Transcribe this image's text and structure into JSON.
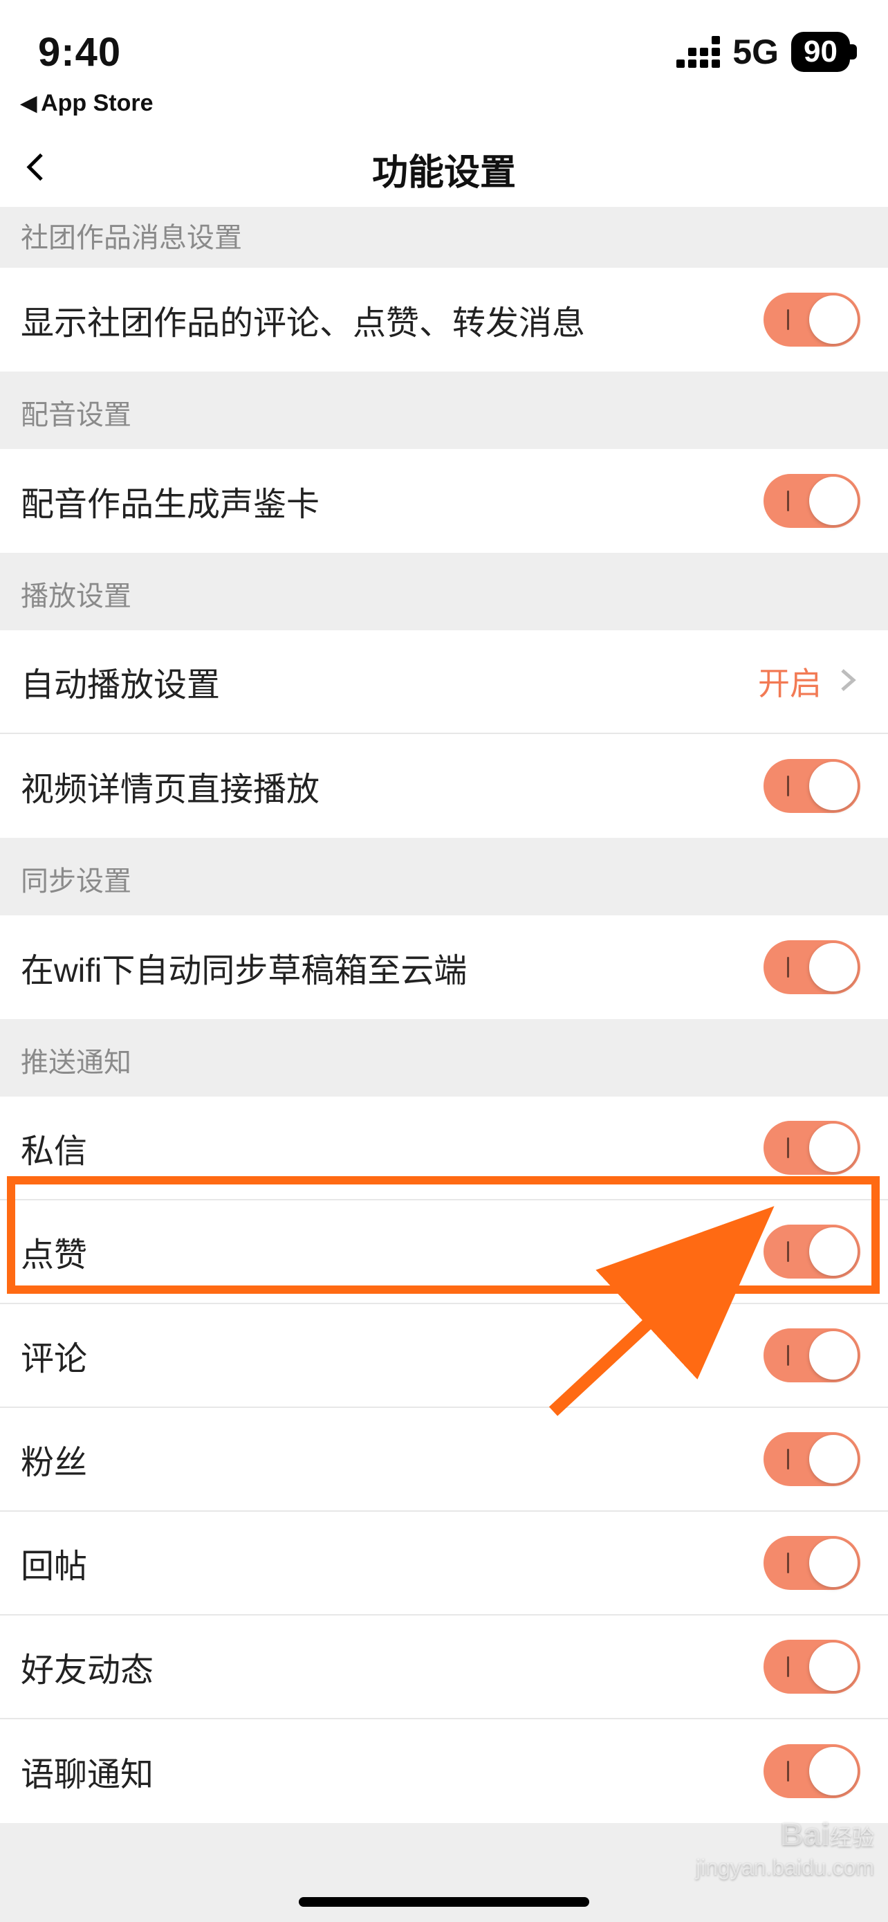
{
  "statusbar": {
    "time": "9:40",
    "network": "5G",
    "battery": "90"
  },
  "breadcrumb": {
    "back_to": "App Store"
  },
  "nav": {
    "title": "功能设置"
  },
  "sections": {
    "s0": {
      "header": "社团作品消息设置"
    },
    "s1": {
      "header": "配音设置"
    },
    "s2": {
      "header": "播放设置"
    },
    "s3": {
      "header": "同步设置"
    },
    "s4": {
      "header": "推送通知"
    }
  },
  "rows": {
    "r0": {
      "label": "显示社团作品的评论、点赞、转发消息",
      "toggle": true
    },
    "r1": {
      "label": "配音作品生成声鉴卡",
      "toggle": true
    },
    "r2": {
      "label": "自动播放设置",
      "value": "开启"
    },
    "r3": {
      "label": "视频详情页直接播放",
      "toggle": true
    },
    "r4": {
      "label": "在wifi下自动同步草稿箱至云端",
      "toggle": true
    },
    "r5": {
      "label": "私信",
      "toggle": true
    },
    "r6": {
      "label": "点赞",
      "toggle": true
    },
    "r7": {
      "label": "评论",
      "toggle": true
    },
    "r8": {
      "label": "粉丝",
      "toggle": true
    },
    "r9": {
      "label": "回帖",
      "toggle": true
    },
    "r10": {
      "label": "好友动态",
      "toggle": true
    },
    "r11": {
      "label": "语聊通知",
      "toggle": true
    }
  },
  "watermark": {
    "brand": "Bai",
    "brand2": "经验",
    "sub": "jingyan.baidu.com"
  },
  "colors": {
    "accent": "#f48a6b",
    "highlight": "#ff6a13",
    "link_value": "#f27a54"
  }
}
